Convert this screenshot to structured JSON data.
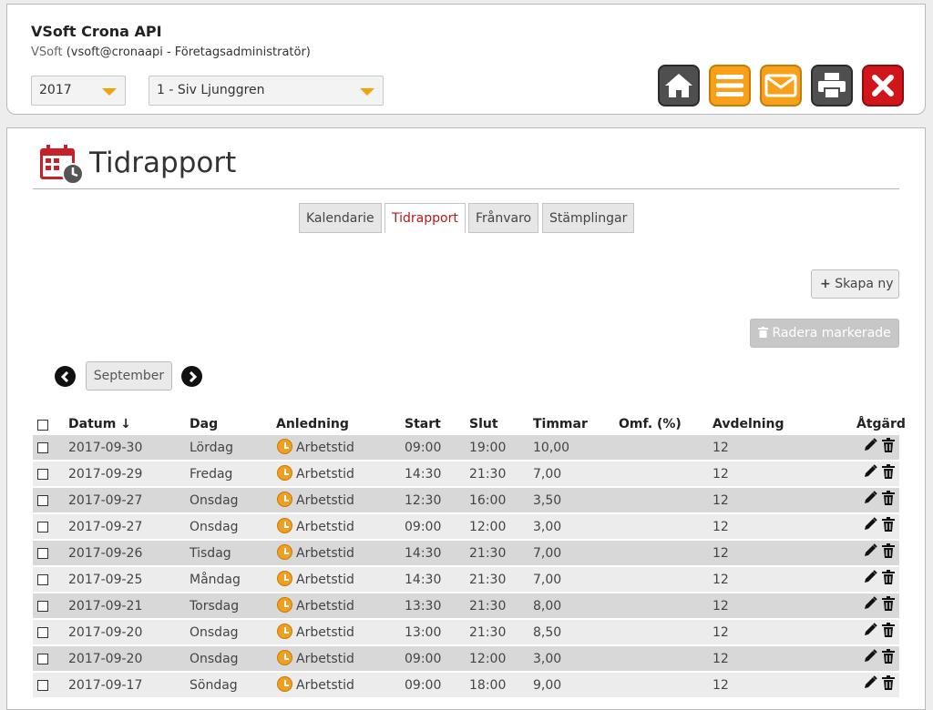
{
  "header": {
    "app_title": "VSoft Crona API",
    "user_brand": "VSoft",
    "user_detail": "(vsoft@cronaapi - Företagsadministratör)",
    "year_select": "2017",
    "person_select": "1 - Siv Ljunggren"
  },
  "toolbar": {
    "icons": [
      "home-icon",
      "menu-icon",
      "mail-icon",
      "print-icon",
      "close-icon"
    ],
    "colors": {
      "dark": "#4f4f4f",
      "orange": "#f7a11a",
      "red": "#d0161b"
    }
  },
  "page": {
    "title": "Tidrapport",
    "tabs": [
      {
        "label": "Kalendarie",
        "active": false
      },
      {
        "label": "Tidrapport",
        "active": true
      },
      {
        "label": "Frånvaro",
        "active": false
      },
      {
        "label": "Stämplingar",
        "active": false
      }
    ],
    "create_label": "Skapa ny",
    "delete_label": "Radera markerade",
    "month": "September"
  },
  "table": {
    "headers": {
      "datum": "Datum ↓",
      "dag": "Dag",
      "anledning": "Anledning",
      "start": "Start",
      "slut": "Slut",
      "timmar": "Timmar",
      "omf": "Omf. (%)",
      "avdelning": "Avdelning",
      "atgard": "Åtgärd"
    },
    "rows": [
      {
        "datum": "2017-09-30",
        "dag": "Lördag",
        "anledning": "Arbetstid",
        "start": "09:00",
        "slut": "19:00",
        "timmar": "10,00",
        "omf": "",
        "avdelning": "12"
      },
      {
        "datum": "2017-09-29",
        "dag": "Fredag",
        "anledning": "Arbetstid",
        "start": "14:30",
        "slut": "21:30",
        "timmar": "7,00",
        "omf": "",
        "avdelning": "12"
      },
      {
        "datum": "2017-09-27",
        "dag": "Onsdag",
        "anledning": "Arbetstid",
        "start": "12:30",
        "slut": "16:00",
        "timmar": "3,50",
        "omf": "",
        "avdelning": "12"
      },
      {
        "datum": "2017-09-27",
        "dag": "Onsdag",
        "anledning": "Arbetstid",
        "start": "09:00",
        "slut": "12:00",
        "timmar": "3,00",
        "omf": "",
        "avdelning": "12"
      },
      {
        "datum": "2017-09-26",
        "dag": "Tisdag",
        "anledning": "Arbetstid",
        "start": "14:30",
        "slut": "21:30",
        "timmar": "7,00",
        "omf": "",
        "avdelning": "12"
      },
      {
        "datum": "2017-09-25",
        "dag": "Måndag",
        "anledning": "Arbetstid",
        "start": "14:30",
        "slut": "21:30",
        "timmar": "7,00",
        "omf": "",
        "avdelning": "12"
      },
      {
        "datum": "2017-09-21",
        "dag": "Torsdag",
        "anledning": "Arbetstid",
        "start": "13:30",
        "slut": "21:30",
        "timmar": "8,00",
        "omf": "",
        "avdelning": "12"
      },
      {
        "datum": "2017-09-20",
        "dag": "Onsdag",
        "anledning": "Arbetstid",
        "start": "13:00",
        "slut": "21:30",
        "timmar": "8,50",
        "omf": "",
        "avdelning": "12"
      },
      {
        "datum": "2017-09-20",
        "dag": "Onsdag",
        "anledning": "Arbetstid",
        "start": "09:00",
        "slut": "12:00",
        "timmar": "3,00",
        "omf": "",
        "avdelning": "12"
      },
      {
        "datum": "2017-09-17",
        "dag": "Söndag",
        "anledning": "Arbetstid",
        "start": "09:00",
        "slut": "18:00",
        "timmar": "9,00",
        "omf": "",
        "avdelning": "12"
      }
    ]
  }
}
